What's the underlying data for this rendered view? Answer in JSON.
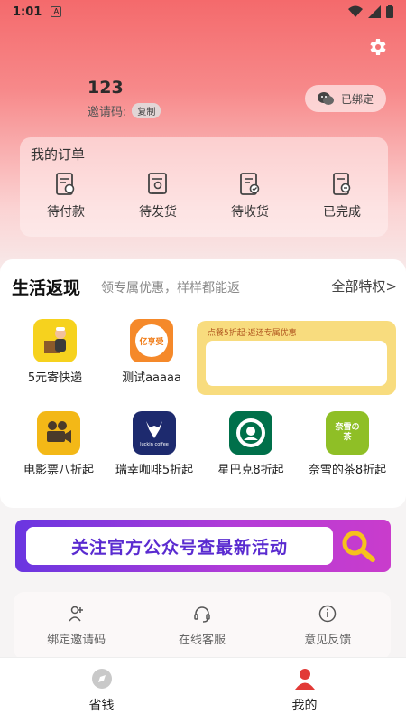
{
  "status": {
    "time": "1:01",
    "notif_letter": "A"
  },
  "profile": {
    "name": "123",
    "invite_label": "邀请码:",
    "copy_label": "复制",
    "bind_label": "已绑定"
  },
  "orders": {
    "title": "我的订单",
    "items": [
      {
        "label": "待付款",
        "icon": "pending-payment-icon"
      },
      {
        "label": "待发货",
        "icon": "pending-shipment-icon"
      },
      {
        "label": "待收货",
        "icon": "pending-receipt-icon"
      },
      {
        "label": "已完成",
        "icon": "completed-icon"
      }
    ]
  },
  "life": {
    "title": "生活返现",
    "subtitle": "领专属优惠，样样都能返",
    "all_label": "全部特权>",
    "services": [
      {
        "label": "5元寄快递",
        "icon": "courier-icon"
      },
      {
        "label": "测试aaaaa",
        "icon": "test-app-icon",
        "icon_text": "亿享受"
      },
      {
        "label": "电影票八折起",
        "icon": "movie-camera-icon"
      },
      {
        "label": "瑞幸咖啡5折起",
        "icon": "luckin-coffee-icon",
        "icon_text": "luckin coffee"
      },
      {
        "label": "星巴克8折起",
        "icon": "starbucks-icon"
      },
      {
        "label": "奈雪的茶8折起",
        "icon": "nayuki-tea-icon",
        "icon_text": "奈雪の茶"
      }
    ],
    "promo_text": "点餐5折起·返还专属优惠"
  },
  "banner": {
    "text": "关注官方公众号查最新活动"
  },
  "tools": [
    {
      "label": "绑定邀请码",
      "icon": "add-user-icon"
    },
    {
      "label": "在线客服",
      "icon": "headset-icon"
    },
    {
      "label": "意见反馈",
      "icon": "info-icon"
    }
  ],
  "tabbar": [
    {
      "label": "省钱",
      "icon": "compass-icon"
    },
    {
      "label": "我的",
      "icon": "user-icon"
    }
  ],
  "colors": {
    "accent": "#f46a6c",
    "promo": "#f8dc7e",
    "banner": "#8a3cdc",
    "active_tab": "#e23a36"
  }
}
